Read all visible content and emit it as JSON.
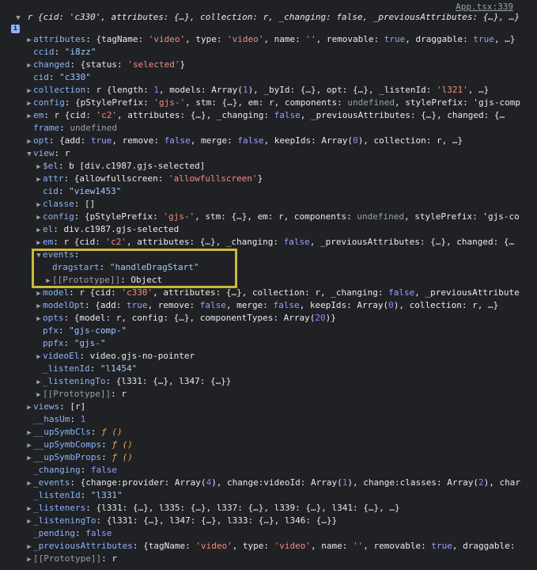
{
  "source_link": "App.tsx:339",
  "header": "r {cid: 'c330', attributes: {…}, collection: r, _changing: false, _previousAttributes: {…}, …}",
  "info_badge": "i",
  "lines": [
    {
      "k": "attributes",
      "v": "{tagName: 'video', type: 'video', name: '', removable: true, draggable: true, …}"
    },
    {
      "k": "ccid",
      "v": "\"i8zz\""
    },
    {
      "k": "changed",
      "v": "{status: 'selected'}"
    },
    {
      "k": "cid",
      "v": "\"c330\""
    },
    {
      "k": "collection",
      "v": "r {length: 1, models: Array(1), _byId: {…}, opt: {…}, _listenId: 'l321', …}"
    },
    {
      "k": "config",
      "v": "{pStylePrefix: 'gjs-', stm: {…}, em: r, components: undefined, stylePrefix: 'gjs-comp"
    },
    {
      "k": "em",
      "v": "r {cid: 'c2', attributes: {…}, _changing: false, _previousAttributes: {…}, changed: {…"
    },
    {
      "k": "frame",
      "v": "undefined"
    },
    {
      "k": "opt",
      "v": "{add: true, remove: false, merge: false, keepIds: Array(0), collection: r, …}"
    },
    {
      "k": "view",
      "v": "r"
    },
    {
      "k": "$el",
      "v": "b [div.c1987.gjs-selected]"
    },
    {
      "k": "attr",
      "v": "{allowfullscreen: 'allowfullscreen'}"
    },
    {
      "k": "cid",
      "v": "\"view1453\""
    },
    {
      "k": "classe",
      "v": "[]"
    },
    {
      "k": "config",
      "v": "{pStylePrefix: 'gjs-', stm: {…}, em: r, components: undefined, stylePrefix: 'gjs-co"
    },
    {
      "k": "el",
      "v": "div.c1987.gjs-selected"
    },
    {
      "k": "em",
      "v": "r {cid: 'c2', attributes: {…}, _changing: false, _previousAttributes: {…}, changed: {…"
    },
    {
      "k": "events",
      "v": ""
    },
    {
      "k": "dragstart",
      "v": "\"handleDragStart\""
    },
    {
      "k": "[[Prototype]]",
      "v": "Object"
    },
    {
      "k": "model",
      "v": "r {cid: 'c330', attributes: {…}, collection: r, _changing: false, _previousAttribute"
    },
    {
      "k": "modelOpt",
      "v": "{add: true, remove: false, merge: false, keepIds: Array(0), collection: r, …}"
    },
    {
      "k": "opts",
      "v": "{model: r, config: {…}, componentTypes: Array(20)}"
    },
    {
      "k": "pfx",
      "v": "\"gjs-comp-\""
    },
    {
      "k": "ppfx",
      "v": "\"gjs-\""
    },
    {
      "k": "videoEl",
      "v": "video.gjs-no-pointer"
    },
    {
      "k": "_listenId",
      "v": "\"l1454\""
    },
    {
      "k": "_listeningTo",
      "v": "{l331: {…}, l347: {…}}"
    },
    {
      "k": "[[Prototype]]",
      "v": "r"
    },
    {
      "k": "views",
      "v": "[r]"
    },
    {
      "k": "__hasUm",
      "v": "1"
    },
    {
      "k": "__upSymbCls",
      "v": "ƒ ()"
    },
    {
      "k": "__upSymbComps",
      "v": "ƒ ()"
    },
    {
      "k": "__upSymbProps",
      "v": "ƒ ()"
    },
    {
      "k": "_changing",
      "v": "false"
    },
    {
      "k": "_events",
      "v": "{change:provider: Array(4), change:videoId: Array(1), change:classes: Array(2), char"
    },
    {
      "k": "_listenId",
      "v": "\"l331\""
    },
    {
      "k": "_listeners",
      "v": "{l331: {…}, l335: {…}, l337: {…}, l339: {…}, l341: {…}, …}"
    },
    {
      "k": "_listeningTo",
      "v": "{l331: {…}, l347: {…}, l333: {…}, l346: {…}}"
    },
    {
      "k": "_pending",
      "v": "false"
    },
    {
      "k": "_previousAttributes",
      "v": "{tagName: 'video', type: 'video', name: '', removable: true, draggable:"
    },
    {
      "k": "[[Prototype]]",
      "v": "r"
    }
  ]
}
